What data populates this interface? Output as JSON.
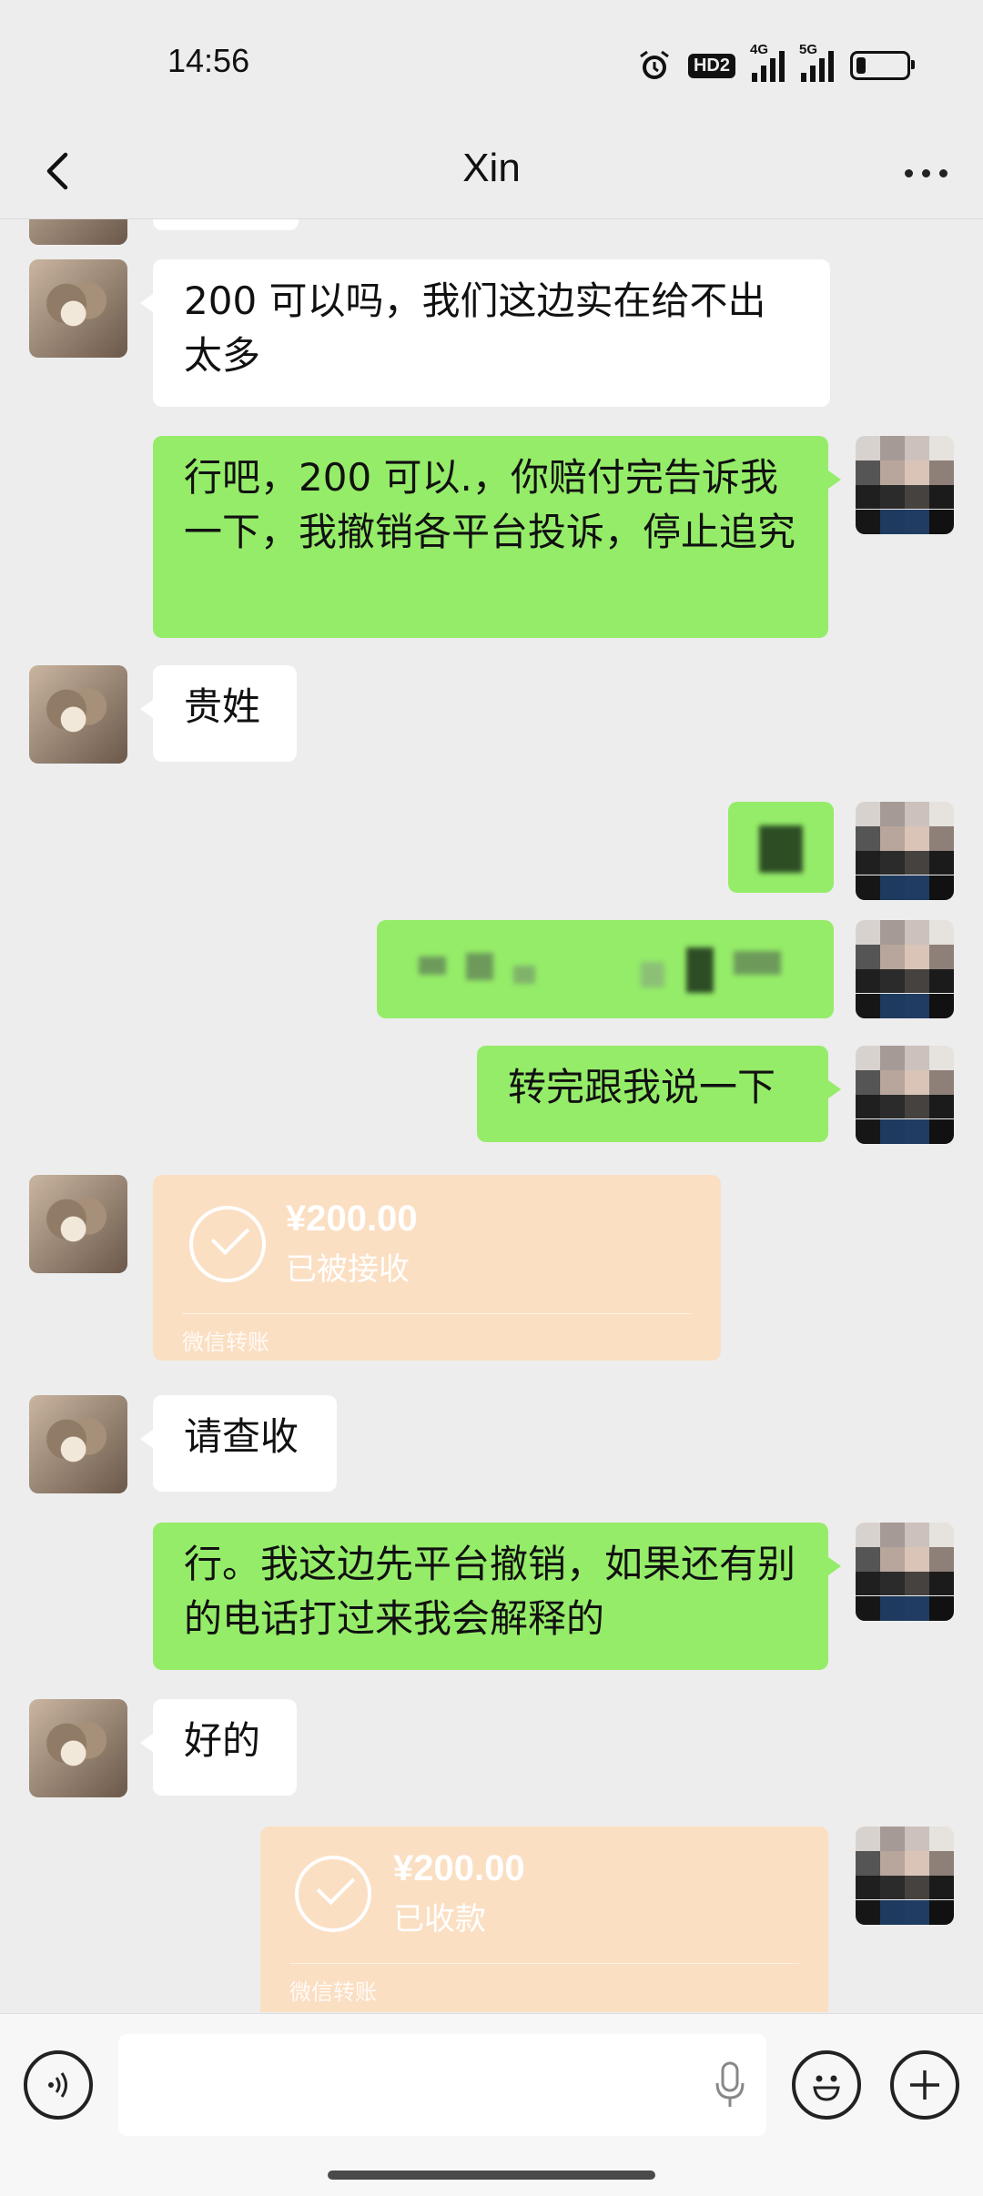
{
  "status_bar": {
    "time": "14:56",
    "hd_label": "HD2",
    "sig1_label": "4G",
    "sig2_label": "5G",
    "battery_level": 0.2
  },
  "nav": {
    "title": "Xin"
  },
  "messages": {
    "m1": "200 可以吗，我们这边实在给不出太多",
    "m2": "行吧，200 可以.，你赔付完告诉我一下，我撤销各平台投诉，停止追究",
    "m3": "贵姓",
    "m6": "转完跟我说一下",
    "t1": {
      "amount": "¥200.00",
      "status": "已被接收",
      "footer": "微信转账"
    },
    "m8": "请查收",
    "m9": "行。我这边先平台撤销，如果还有别的电话打过来我会解释的",
    "m10": "好的",
    "t2": {
      "amount": "¥200.00",
      "status": "已收款",
      "footer": "微信转账"
    }
  },
  "colors": {
    "incoming": "#ffffff",
    "outgoing": "#95ec69",
    "transfer": "#fbdfc3",
    "background": "#ededed"
  }
}
